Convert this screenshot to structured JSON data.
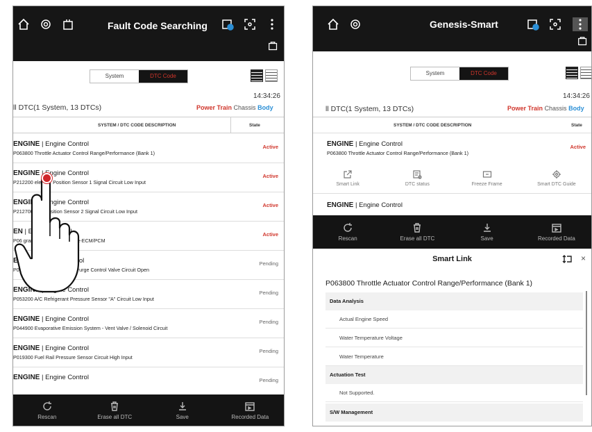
{
  "left": {
    "app_title": "Fault Code Searching",
    "tab_system": "System",
    "tab_dtc": "DTC Code",
    "time": "14:34:26",
    "summary": "ll DTC(1 System, 13 DTCs)",
    "cat_powertrain": "Power Train",
    "cat_chassis": "Chassis",
    "cat_body": "Body",
    "col_desc": "SYSTEM / DTC CODE DESCRIPTION",
    "col_state": "State",
    "rows": [
      {
        "sys": "ENGINE",
        "sub": "Engine Control",
        "code": "P063800 Throttle Actuator Control Range/Performance (Bank 1)",
        "state": "Active"
      },
      {
        "sys": "ENGINE",
        "sub": "Engine Control",
        "code": "P212200   elerator Position Sensor 1 Signal Circuit Low Input",
        "state": "Active"
      },
      {
        "sys": "ENGINE",
        "sub": "Engine Control",
        "code": "P2127001         tor Position Sensor 2 Signal Circuit Low Input",
        "state": "Active"
      },
      {
        "sys": "EN",
        "sub": "Engine Control",
        "code": "P06              grammed or Incompatible-ECM/PCM",
        "state": "Active"
      },
      {
        "sys": "ENGIN",
        "sub": "Engine Control",
        "code": "P04440          e Emission System-Purge Control Valve Circuit Open",
        "state": "Pending"
      },
      {
        "sys": "ENGINE",
        "sub": "Engine Control",
        "code": "P053200 A/C Refrigerant Pressure Sensor \"A\" Circuit Low Input",
        "state": "Pending"
      },
      {
        "sys": "ENGINE",
        "sub": "Engine Control",
        "code": "P044900 Evaporative Emission System - Vent Valve / Solenoid Circuit",
        "state": "Pending"
      },
      {
        "sys": "ENGINE",
        "sub": "Engine Control",
        "code": "P019300 Fuel Rail Pressure Sensor Circuit High Input",
        "state": "Pending"
      },
      {
        "sys": "ENGINE",
        "sub": "Engine Control",
        "code": "",
        "state": "Pending"
      }
    ],
    "bottom": [
      "Rescan",
      "Erase all DTC",
      "Save",
      "Recorded Data"
    ]
  },
  "right": {
    "app_title": "Genesis-Smart",
    "tab_system": "System",
    "tab_dtc": "DTC Code",
    "time": "14:34:26",
    "summary": "ll DTC(1 System, 13 DTCs)",
    "cat_powertrain": "Power Train",
    "cat_chassis": "Chassis",
    "cat_body": "Body",
    "col_desc": "SYSTEM / DTC CODE DESCRIPTION",
    "col_state": "State",
    "row1": {
      "sys": "ENGINE",
      "sub": "Engine Control",
      "code": "P063800 Throttle Actuator Control Range/Performance (Bank 1)",
      "state": "Active"
    },
    "actions": [
      "Smart Link",
      "DTC status",
      "Freeze Frame",
      "Smart DTC Guide"
    ],
    "row2": {
      "sys": "ENGINE",
      "sub": "Engine Control"
    },
    "bottom": [
      "Rescan",
      "Erase all DTC",
      "Save",
      "Recorded Data"
    ],
    "smartlink": {
      "title": "Smart Link",
      "close": "×",
      "dtc_title": "P063800 Throttle Actuator Control Range/Performance (Bank 1)",
      "sections": [
        {
          "name": "Data Analysis",
          "items": [
            "Actual Engine Speed",
            "Water Temperature Voltage",
            "Water Temperature"
          ]
        },
        {
          "name": "Actuation Test",
          "items": [
            "Not Supported."
          ]
        },
        {
          "name": "S/W Management",
          "items": []
        }
      ]
    }
  }
}
